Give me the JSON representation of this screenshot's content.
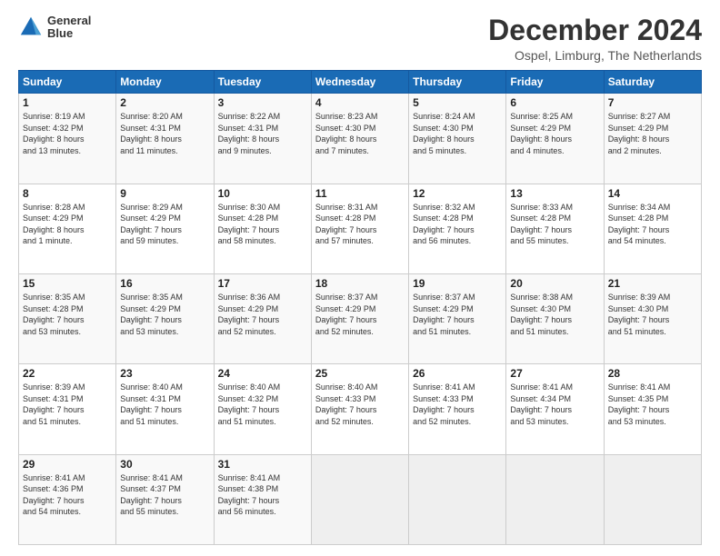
{
  "header": {
    "logo_line1": "General",
    "logo_line2": "Blue",
    "month": "December 2024",
    "location": "Ospel, Limburg, The Netherlands"
  },
  "weekdays": [
    "Sunday",
    "Monday",
    "Tuesday",
    "Wednesday",
    "Thursday",
    "Friday",
    "Saturday"
  ],
  "weeks": [
    [
      {
        "day": "1",
        "info": "Sunrise: 8:19 AM\nSunset: 4:32 PM\nDaylight: 8 hours\nand 13 minutes."
      },
      {
        "day": "2",
        "info": "Sunrise: 8:20 AM\nSunset: 4:31 PM\nDaylight: 8 hours\nand 11 minutes."
      },
      {
        "day": "3",
        "info": "Sunrise: 8:22 AM\nSunset: 4:31 PM\nDaylight: 8 hours\nand 9 minutes."
      },
      {
        "day": "4",
        "info": "Sunrise: 8:23 AM\nSunset: 4:30 PM\nDaylight: 8 hours\nand 7 minutes."
      },
      {
        "day": "5",
        "info": "Sunrise: 8:24 AM\nSunset: 4:30 PM\nDaylight: 8 hours\nand 5 minutes."
      },
      {
        "day": "6",
        "info": "Sunrise: 8:25 AM\nSunset: 4:29 PM\nDaylight: 8 hours\nand 4 minutes."
      },
      {
        "day": "7",
        "info": "Sunrise: 8:27 AM\nSunset: 4:29 PM\nDaylight: 8 hours\nand 2 minutes."
      }
    ],
    [
      {
        "day": "8",
        "info": "Sunrise: 8:28 AM\nSunset: 4:29 PM\nDaylight: 8 hours\nand 1 minute."
      },
      {
        "day": "9",
        "info": "Sunrise: 8:29 AM\nSunset: 4:29 PM\nDaylight: 7 hours\nand 59 minutes."
      },
      {
        "day": "10",
        "info": "Sunrise: 8:30 AM\nSunset: 4:28 PM\nDaylight: 7 hours\nand 58 minutes."
      },
      {
        "day": "11",
        "info": "Sunrise: 8:31 AM\nSunset: 4:28 PM\nDaylight: 7 hours\nand 57 minutes."
      },
      {
        "day": "12",
        "info": "Sunrise: 8:32 AM\nSunset: 4:28 PM\nDaylight: 7 hours\nand 56 minutes."
      },
      {
        "day": "13",
        "info": "Sunrise: 8:33 AM\nSunset: 4:28 PM\nDaylight: 7 hours\nand 55 minutes."
      },
      {
        "day": "14",
        "info": "Sunrise: 8:34 AM\nSunset: 4:28 PM\nDaylight: 7 hours\nand 54 minutes."
      }
    ],
    [
      {
        "day": "15",
        "info": "Sunrise: 8:35 AM\nSunset: 4:28 PM\nDaylight: 7 hours\nand 53 minutes."
      },
      {
        "day": "16",
        "info": "Sunrise: 8:35 AM\nSunset: 4:29 PM\nDaylight: 7 hours\nand 53 minutes."
      },
      {
        "day": "17",
        "info": "Sunrise: 8:36 AM\nSunset: 4:29 PM\nDaylight: 7 hours\nand 52 minutes."
      },
      {
        "day": "18",
        "info": "Sunrise: 8:37 AM\nSunset: 4:29 PM\nDaylight: 7 hours\nand 52 minutes."
      },
      {
        "day": "19",
        "info": "Sunrise: 8:37 AM\nSunset: 4:29 PM\nDaylight: 7 hours\nand 51 minutes."
      },
      {
        "day": "20",
        "info": "Sunrise: 8:38 AM\nSunset: 4:30 PM\nDaylight: 7 hours\nand 51 minutes."
      },
      {
        "day": "21",
        "info": "Sunrise: 8:39 AM\nSunset: 4:30 PM\nDaylight: 7 hours\nand 51 minutes."
      }
    ],
    [
      {
        "day": "22",
        "info": "Sunrise: 8:39 AM\nSunset: 4:31 PM\nDaylight: 7 hours\nand 51 minutes."
      },
      {
        "day": "23",
        "info": "Sunrise: 8:40 AM\nSunset: 4:31 PM\nDaylight: 7 hours\nand 51 minutes."
      },
      {
        "day": "24",
        "info": "Sunrise: 8:40 AM\nSunset: 4:32 PM\nDaylight: 7 hours\nand 51 minutes."
      },
      {
        "day": "25",
        "info": "Sunrise: 8:40 AM\nSunset: 4:33 PM\nDaylight: 7 hours\nand 52 minutes."
      },
      {
        "day": "26",
        "info": "Sunrise: 8:41 AM\nSunset: 4:33 PM\nDaylight: 7 hours\nand 52 minutes."
      },
      {
        "day": "27",
        "info": "Sunrise: 8:41 AM\nSunset: 4:34 PM\nDaylight: 7 hours\nand 53 minutes."
      },
      {
        "day": "28",
        "info": "Sunrise: 8:41 AM\nSunset: 4:35 PM\nDaylight: 7 hours\nand 53 minutes."
      }
    ],
    [
      {
        "day": "29",
        "info": "Sunrise: 8:41 AM\nSunset: 4:36 PM\nDaylight: 7 hours\nand 54 minutes."
      },
      {
        "day": "30",
        "info": "Sunrise: 8:41 AM\nSunset: 4:37 PM\nDaylight: 7 hours\nand 55 minutes."
      },
      {
        "day": "31",
        "info": "Sunrise: 8:41 AM\nSunset: 4:38 PM\nDaylight: 7 hours\nand 56 minutes."
      },
      null,
      null,
      null,
      null
    ]
  ]
}
